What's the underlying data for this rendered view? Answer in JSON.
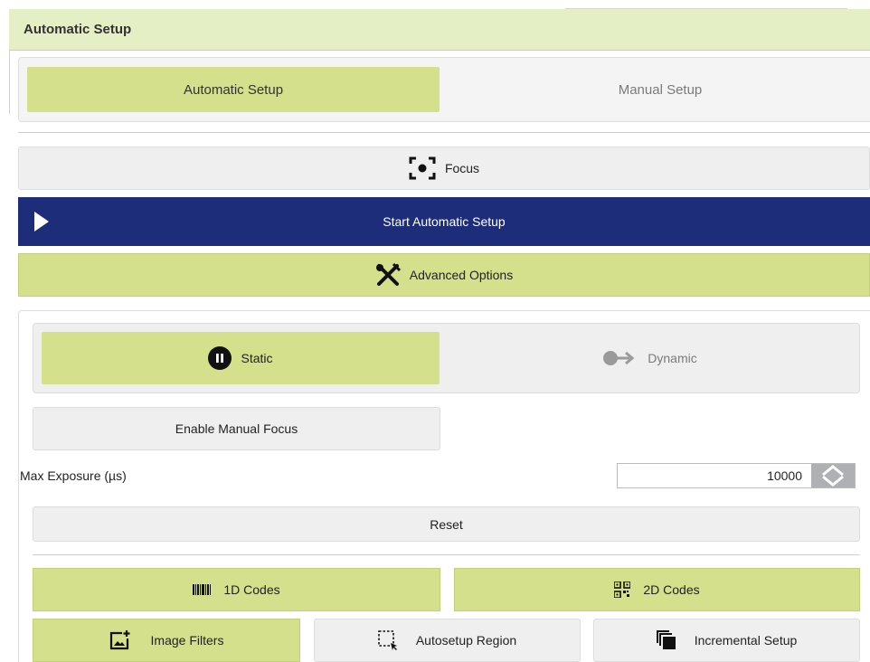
{
  "panel": {
    "title": "Automatic Setup"
  },
  "setup_tabs": [
    {
      "label": "Automatic Setup",
      "active": true
    },
    {
      "label": "Manual Setup",
      "active": false
    }
  ],
  "focus_button": {
    "label": "Focus",
    "icon": "focus-icon"
  },
  "start_button": {
    "label": "Start Automatic Setup",
    "icon": "play-icon"
  },
  "advanced_button": {
    "label": "Advanced Options",
    "icon": "tools-icon"
  },
  "mode_tabs": [
    {
      "label": "Static",
      "icon": "pause-circle-icon",
      "active": true
    },
    {
      "label": "Dynamic",
      "icon": "arrow-right-icon",
      "active": false
    }
  ],
  "manual_focus_button": {
    "label": "Enable Manual Focus"
  },
  "max_exposure": {
    "label": "Max Exposure (µs)",
    "value": "10000"
  },
  "reset_button": {
    "label": "Reset"
  },
  "code_buttons": [
    {
      "label": "1D Codes",
      "icon": "barcode-icon",
      "active": true
    },
    {
      "label": "2D Codes",
      "icon": "qr-code-icon",
      "active": true
    }
  ],
  "bottom_buttons": [
    {
      "label": "Image Filters",
      "icon": "image-filter-icon",
      "active": true
    },
    {
      "label": "Autosetup Region",
      "icon": "region-select-icon",
      "active": false
    },
    {
      "label": "Incremental Setup",
      "icon": "stacked-copy-icon",
      "active": false
    }
  ],
  "colors": {
    "accent_green": "#d4e08b",
    "header_green": "#e5efc6",
    "primary_blue": "#1e2d7a",
    "neutral_grey": "#efefef"
  }
}
